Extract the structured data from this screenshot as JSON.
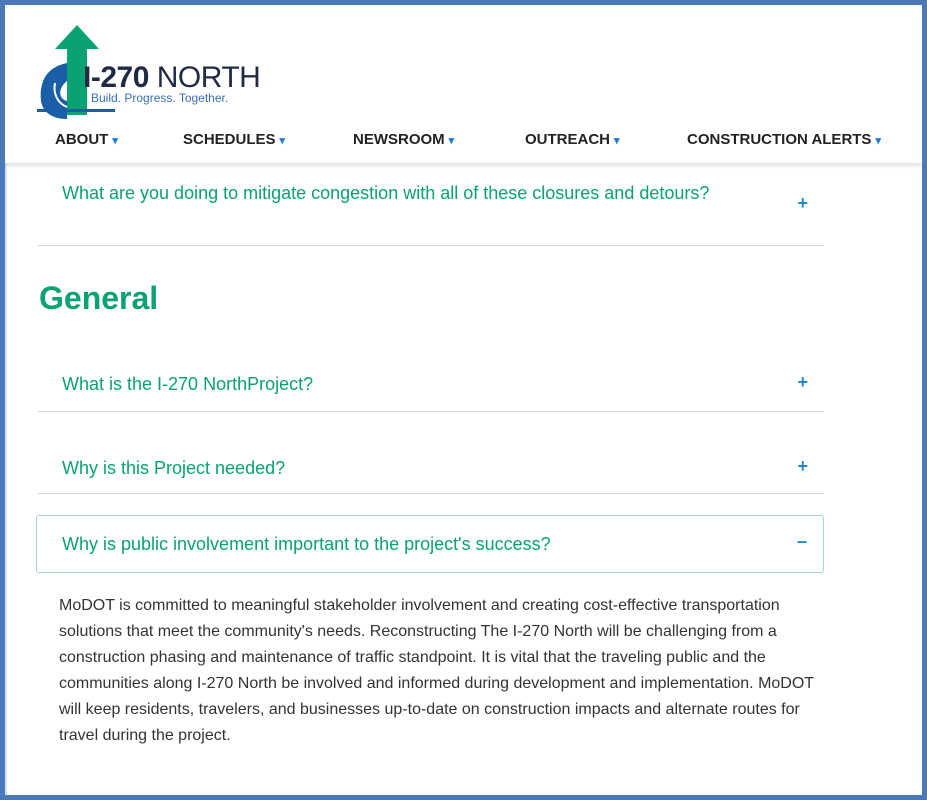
{
  "brand": {
    "title_bold": "I-270",
    "title_light": "NORTH",
    "tagline": "Build. Progress. Together."
  },
  "nav": [
    {
      "label": "ABOUT"
    },
    {
      "label": "SCHEDULES"
    },
    {
      "label": "NEWSROOM"
    },
    {
      "label": "OUTREACH"
    },
    {
      "label": "CONSTRUCTION ALERTS"
    }
  ],
  "icons": {
    "caret": "▾",
    "plus": "+",
    "minus": "–"
  },
  "faq_top": {
    "question": "What are you doing to mitigate congestion with all of these closures and detours?"
  },
  "section": {
    "title": "General"
  },
  "faq_general": [
    {
      "question": "What is the I-270 NorthProject?"
    },
    {
      "question": "Why is this Project needed?"
    },
    {
      "question": "Why is public involvement important to the project's success?"
    }
  ],
  "answer": {
    "text": "MoDOT is committed to meaningful stakeholder involvement and creating cost-effective transportation solutions that meet the community's needs. Reconstructing The I-270 North will be challenging from a construction phasing and maintenance of traffic standpoint. It is vital that the traveling public and the communities along I-270 North be involved and informed during development and implementation. MoDOT will keep residents, travelers, and businesses up-to-date on construction impacts and alternate routes for travel during the project."
  },
  "colors": {
    "accent": "#0aa173",
    "link_blue": "#1e88c9",
    "frame": "#4a78b8"
  }
}
